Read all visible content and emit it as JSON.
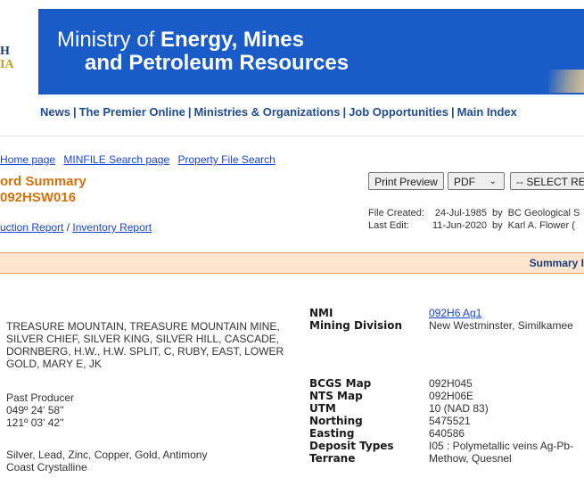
{
  "header": {
    "logo_lines": [
      "H",
      "IA"
    ],
    "title_line1_pre": "Ministry of ",
    "title_line1_bold": "Energy, Mines",
    "title_line2": "and Petroleum Resources"
  },
  "topnav": {
    "items": [
      "News",
      "The Premier Online",
      "Ministries & Organizations",
      "Job Opportunities",
      "Main Index"
    ],
    "separator": "|"
  },
  "breadcrumbs": [
    "Home page",
    "MINFILE Search page",
    "Property File Search"
  ],
  "record": {
    "title": "ord Summary",
    "id": "092HSW016"
  },
  "report_links": {
    "production": "uction Report",
    "slash": " / ",
    "inventory": "Inventory Report"
  },
  "controls": {
    "print_preview": "Print Preview",
    "pdf": "PDF",
    "select_report": "-- SELECT RE"
  },
  "meta": {
    "created_label": "File Created:",
    "created_date": "24-Jul-1985",
    "created_by": "by  BC Geological S",
    "edit_label": "Last Edit:",
    "edit_date": "11-Jun-2020",
    "edit_by": "by  Karl A. Flower ("
  },
  "summary_band": {
    "label": "Summary I"
  },
  "details_left": {
    "names": "TREASURE MOUNTAIN, TREASURE MOUNTAIN MINE, SILVER CHIEF, SILVER KING, SILVER HILL, CASCADE, DORNBERG, H.W., H.W. SPLIT, C, RUBY, EAST, LOWER GOLD, MARY E, JK",
    "status": "Past Producer",
    "latitude": "049º 24' 58''",
    "longitude": "121º 03' 42''",
    "commodities": "Silver, Lead, Zinc, Copper, Gold, Antimony",
    "tectonic_belt": "Coast Crystalline"
  },
  "details_right": {
    "nmi_label": "NMI",
    "nmi_value": "092H6 Ag1",
    "mining_division_label": "Mining Division",
    "mining_division_value": "New Westminster, Similkamee",
    "bcgs_label": "BCGS Map",
    "bcgs_value": "092H045",
    "nts_label": "NTS Map",
    "nts_value": "092H06E",
    "utm_label": "UTM",
    "utm_value": "10 (NAD 83)",
    "northing_label": "Northing",
    "northing_value": "5475521",
    "easting_label": "Easting",
    "easting_value": "640586",
    "deposit_label": "Deposit Types",
    "deposit_value": "I05 : Polymetallic veins Ag-Pb-",
    "terrane_label": "Terrane",
    "terrane_value": "Methow, Quesnel"
  }
}
